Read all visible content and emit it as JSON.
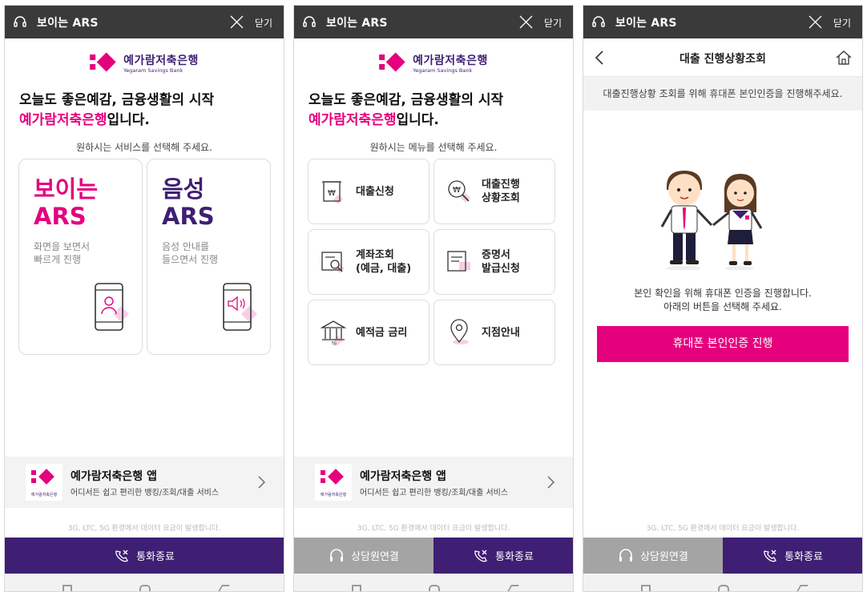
{
  "common": {
    "title": "보이는 ARS",
    "close_label": "닫기",
    "logo_ko": "예가람저축은행",
    "logo_en": "Yegaram Savings Bank",
    "headline_line1": "오늘도 좋은예감,  금융생활의 시작",
    "headline_brand": "예가람저축은행",
    "headline_tail": "입니다.",
    "app_name": "예가람저축은행 앱",
    "app_desc": "어디서든 쉽고 편리한 뱅킹/조회/대출 서비스",
    "app_logo_caption": "예가람저축은행",
    "data_notice": "3G, LTC, 5G 환경에서 데이터 요금이 발생합니다.",
    "end_call_label": "통화종료",
    "agent_label": "상담원연결"
  },
  "colors": {
    "brand_pink": "#e5007e",
    "brand_purple": "#3f1f74",
    "topbar": "#3a3a3a",
    "gray_button": "#a4a4a4"
  },
  "panel1": {
    "subtitle": "원하시는 서비스를 선택해 주세요.",
    "cards": [
      {
        "title_line1": "보이는",
        "title_line2": "ARS",
        "desc_line1": "화면을 보면서",
        "desc_line2": "빠르게 진행",
        "icon": "person-phone-icon"
      },
      {
        "title_line1": "음성",
        "title_line2": "ARS",
        "desc_line1": "음성 안내를",
        "desc_line2": "들으면서 진행",
        "icon": "speaker-phone-icon"
      }
    ]
  },
  "panel2": {
    "subtitle": "원하시는 메뉴를 선택해 주세요.",
    "menu": [
      {
        "label": "대출신청",
        "icon": "loan-document-icon"
      },
      {
        "label": "대출진행\n상황조회",
        "icon": "loan-search-icon"
      },
      {
        "label": "계좌조회\n(예금, 대출)",
        "icon": "account-lookup-icon"
      },
      {
        "label": "증명서\n발급신청",
        "icon": "certificate-icon"
      },
      {
        "label": "예적금 금리",
        "icon": "bank-rate-icon"
      },
      {
        "label": "지점안내",
        "icon": "location-pin-icon"
      }
    ]
  },
  "panel3": {
    "page_title": "대출 진행상황조회",
    "info_text": "대출진행상황 조회를 위해 휴대폰 본인인증을 진행해주세요.",
    "msg_line1": "본인 확인을 위해 휴대폰 인증을 진행합니다.",
    "msg_line2": "아래의 버튼을 선택해 주세요.",
    "cta_label": "휴대폰 본인인증 진행"
  }
}
